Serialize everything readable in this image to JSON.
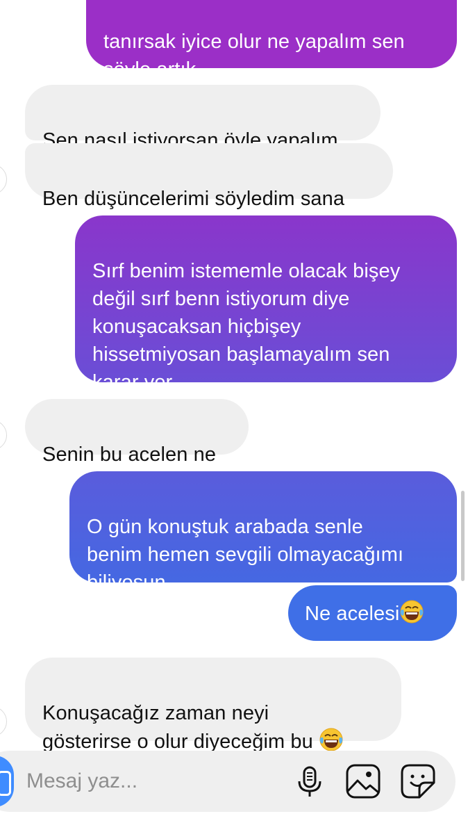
{
  "conversation": {
    "messages": [
      {
        "id": "m1",
        "direction": "outgoing",
        "text": "tanırsak iyice olur ne yapalım sen\nsöyle artık"
      },
      {
        "id": "m2",
        "direction": "incoming",
        "text": "Sen nasıl istiyorsan öyle yapalım"
      },
      {
        "id": "m3",
        "direction": "incoming",
        "text": "Ben düşüncelerimi söyledim sana"
      },
      {
        "id": "m4",
        "direction": "outgoing",
        "text": "Sırf benim istememle olacak bişey\ndeğil sırf benn istiyorum diye\nkonuşacaksan hiçbişey\nhissetmiyosan başlamayalım sen\nkarar ver"
      },
      {
        "id": "m5",
        "direction": "incoming",
        "text": "Senin bu acelen ne"
      },
      {
        "id": "m6",
        "direction": "outgoing",
        "text": "O gün konuştuk arabada senle\nbenim hemen sevgili olmayacağımı\nbiliyosun"
      },
      {
        "id": "m7",
        "direction": "outgoing",
        "text": "Ne acelesi",
        "emoji": "tears-of-joy"
      },
      {
        "id": "m8",
        "direction": "incoming",
        "text": "Konuşacağız zaman neyi\ngösterirse o olur diyeceğim bu ",
        "emoji": "tears-of-joy"
      }
    ]
  },
  "composer": {
    "placeholder": "Mesaj yaz...",
    "value": "",
    "icons": [
      "camera-icon",
      "microphone-icon",
      "image-icon",
      "sticker-icon"
    ]
  },
  "colors": {
    "incoming_bubble": "#efefef",
    "gradient_top": "#9b2fc7",
    "gradient_mid": "#6c4fd6",
    "gradient_bottom": "#3e6fe6",
    "composer_bg": "#efefef",
    "camera_button": "#3f8cff"
  }
}
